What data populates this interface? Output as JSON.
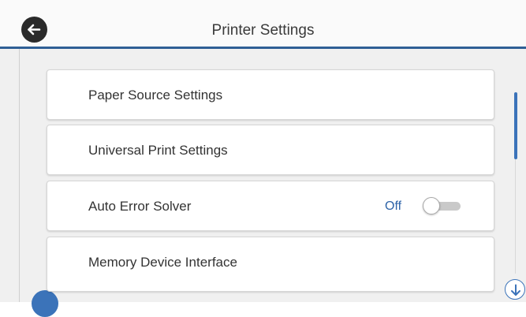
{
  "header": {
    "title": "Printer Settings",
    "back_icon": "back-arrow-icon"
  },
  "menu": {
    "items": [
      {
        "label": "Paper Source Settings"
      },
      {
        "label": "Universal Print Settings"
      },
      {
        "label": "Auto Error Solver",
        "toggle_status": "Off",
        "toggle_on": false
      },
      {
        "label": "Memory Device Interface"
      }
    ]
  },
  "scroll": {
    "down_icon": "scroll-down-arrow-icon"
  },
  "colors": {
    "accent": "#3b73b9",
    "header_rule": "#2f5f95",
    "status_text": "#2d63a8",
    "background": "#f0f0f0"
  }
}
